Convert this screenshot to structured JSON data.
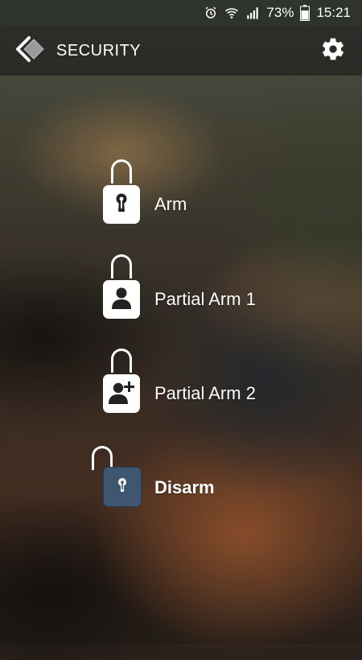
{
  "status_bar": {
    "battery_percent": "73%",
    "time": "15:21",
    "icons": [
      "alarm-icon",
      "wifi-icon",
      "signal-icon",
      "battery-icon"
    ]
  },
  "app_bar": {
    "title": "SECURITY",
    "back_icon": "back-chevron-icon",
    "settings_icon": "gear-icon"
  },
  "menu": {
    "items": [
      {
        "label": "Arm",
        "icon": "keyhole-icon",
        "state": "locked"
      },
      {
        "label": "Partial Arm 1",
        "icon": "person-icon",
        "state": "locked"
      },
      {
        "label": "Partial Arm 2",
        "icon": "person-add-icon",
        "state": "locked"
      },
      {
        "label": "Disarm",
        "icon": "keyhole-icon",
        "state": "unlocked",
        "selected": true
      }
    ]
  },
  "colors": {
    "text": "#ffffff",
    "lock_body": "#ffffff",
    "lock_icon": "#222222",
    "disarm_body": "#3f5670"
  }
}
